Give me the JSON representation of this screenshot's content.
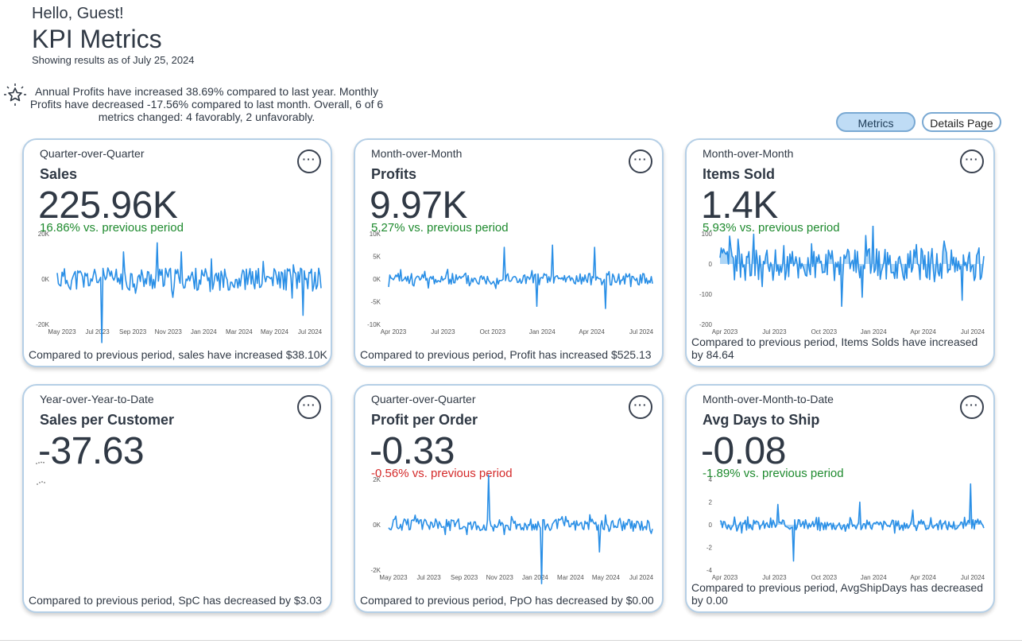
{
  "header": {
    "greeting": "Hello, Guest!",
    "title": "KPI Metrics",
    "as_of": "Showing results as of July 25, 2024"
  },
  "insight": {
    "icon": "sparkle-star-icon",
    "text": "Annual Profits have increased 38.69% compared to last year. Monthly Profits have decreased -17.56% compared to last month. Overall, 6 of 6 metrics changed: 4 favorably, 2 unfavorably."
  },
  "toggles": {
    "metrics_label": "Metrics",
    "details_label": "Details Page",
    "active": "Metrics"
  },
  "colors": {
    "line": "#2a8fe6",
    "area": "#8cc4f2",
    "positive": "#1e8a2e",
    "negative": "#d42a2a"
  },
  "cards": [
    {
      "period": "Quarter-over-Quarter",
      "name": "Sales",
      "value": "225.96K",
      "change": "16.86% vs. previous period",
      "change_dir": "up",
      "footer": "Compared to previous period, sales have increased $38.10K",
      "chart": {
        "y_ticks": [
          "20K",
          "0K",
          "-20K"
        ],
        "x_ticks": [
          "May 2023",
          "Jul 2023",
          "Sep 2023",
          "Nov 2023",
          "Jan 2024",
          "Mar 2024",
          "May 2024",
          "Jul 2024"
        ],
        "ylim": [
          -20000,
          20000
        ],
        "spikes": [
          [
            0.17,
            -28000
          ],
          [
            0.25,
            12000
          ],
          [
            0.38,
            16000
          ],
          [
            0.47,
            12000
          ],
          [
            0.93,
            -16000
          ]
        ],
        "amp": 5000,
        "seed": 11,
        "fill": false
      }
    },
    {
      "period": "Month-over-Month",
      "name": "Profits",
      "value": "9.97K",
      "change": "5.27% vs. previous period",
      "change_dir": "up",
      "footer": "Compared to previous period, Profit has increased $525.13",
      "chart": {
        "y_ticks": [
          "10K",
          "5K",
          "0K",
          "-5K",
          "-10K"
        ],
        "x_ticks": [
          "Apr 2023",
          "Jul 2023",
          "Oct 2023",
          "Jan 2024",
          "Apr 2024",
          "Jul 2024"
        ],
        "ylim": [
          -10000,
          10000
        ],
        "spikes": [
          [
            0.44,
            7000
          ],
          [
            0.5,
            -8000
          ],
          [
            0.62,
            7500
          ],
          [
            0.78,
            7000
          ],
          [
            0.82,
            -6500
          ],
          [
            0.56,
            -6000
          ]
        ],
        "amp": 1300,
        "seed": 23,
        "fill": false
      }
    },
    {
      "period": "Month-over-Month",
      "name": "Items Sold",
      "value": "1.4K",
      "change": "5.93% vs. previous period",
      "change_dir": "up",
      "footer": "Compared to previous period, Items Solds have increased by 84.64",
      "chart": {
        "y_ticks": [
          "100",
          "0",
          "-100",
          "-200"
        ],
        "x_ticks": [
          "Apr 2023",
          "Jul 2023",
          "Oct 2023",
          "Jan 2024",
          "Apr 2024",
          "Jul 2024"
        ],
        "ylim": [
          -200,
          100
        ],
        "spikes": [
          [
            0.46,
            -140
          ],
          [
            0.5,
            140
          ],
          [
            0.58,
            130
          ],
          [
            0.54,
            -110
          ],
          [
            0.92,
            -120
          ]
        ],
        "amp": 55,
        "seed": 37,
        "fill": true
      }
    },
    {
      "period": "Year-over-Year-to-Date",
      "name": "Sales per Customer",
      "value": "-37.63",
      "change": "",
      "change_dir": "",
      "footer": "Compared to previous period, SpC has decreased by $3.03",
      "chart": null
    },
    {
      "period": "Quarter-over-Quarter",
      "name": "Profit per Order",
      "value": "-0.33",
      "change": "-0.56% vs. previous period",
      "change_dir": "down",
      "footer": "Compared to previous period, PpO has decreased by $0.00",
      "chart": {
        "y_ticks": [
          "2K",
          "0K",
          "-2K"
        ],
        "x_ticks": [
          "May 2023",
          "Jul 2023",
          "Sep 2023",
          "Nov 2023",
          "Jan 2024",
          "Mar 2024",
          "May 2024",
          "Jul 2024"
        ],
        "ylim": [
          -2000,
          2000
        ],
        "spikes": [
          [
            0.38,
            2200
          ],
          [
            0.58,
            -2600
          ],
          [
            0.8,
            -1200
          ]
        ],
        "amp": 260,
        "seed": 51,
        "fill": false
      }
    },
    {
      "period": "Month-over-Month-to-Date",
      "name": "Avg Days to Ship",
      "value": "-0.08",
      "change": "-1.89% vs. previous period",
      "change_dir": "up",
      "footer": "Compared to previous period, AvgShipDays has decreased by 0.00",
      "chart": {
        "y_ticks": [
          "4",
          "2",
          "0",
          "-2",
          "-4"
        ],
        "x_ticks": [
          "Apr 2023",
          "Jul 2023",
          "Oct 2023",
          "Jan 2024",
          "Apr 2024",
          "Jul 2024"
        ],
        "ylim": [
          -4,
          4
        ],
        "spikes": [
          [
            0.28,
            -3.2
          ],
          [
            0.22,
            1.8
          ],
          [
            0.53,
            2.0
          ],
          [
            0.95,
            3.6
          ],
          [
            0.73,
            1.3
          ]
        ],
        "amp": 0.45,
        "seed": 67,
        "fill": true
      }
    }
  ]
}
